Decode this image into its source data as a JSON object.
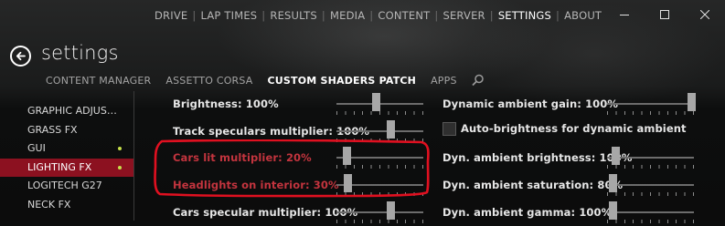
{
  "topnav": {
    "items": [
      {
        "label": "DRIVE",
        "active": false
      },
      {
        "label": "LAP TIMES",
        "active": false
      },
      {
        "label": "RESULTS",
        "active": false
      },
      {
        "label": "MEDIA",
        "active": false
      },
      {
        "label": "CONTENT",
        "active": false
      },
      {
        "label": "SERVER",
        "active": false
      },
      {
        "label": "SETTINGS",
        "active": true
      },
      {
        "label": "ABOUT",
        "active": false
      }
    ],
    "separator": "|"
  },
  "window_controls": [
    "minimize-icon",
    "maximize-icon",
    "close-icon"
  ],
  "page": {
    "title": "settings"
  },
  "subtabs": [
    {
      "label": "CONTENT MANAGER",
      "active": false
    },
    {
      "label": "ASSETTO CORSA",
      "active": false
    },
    {
      "label": "CUSTOM SHADERS PATCH",
      "active": true
    },
    {
      "label": "APPS",
      "active": false
    }
  ],
  "sidebar": {
    "items": [
      {
        "label": "GRAPHIC ADJUS…",
        "active": false,
        "dot": false
      },
      {
        "label": "GRASS FX",
        "active": false,
        "dot": false
      },
      {
        "label": "GUI",
        "active": false,
        "dot": true,
        "dot_color": "#c7e04a"
      },
      {
        "label": "LIGHTING FX",
        "active": true,
        "dot": true,
        "dot_color": "#c7e04a"
      },
      {
        "label": "LOGITECH G27",
        "active": false,
        "dot": false
      },
      {
        "label": "NECK FX",
        "active": false,
        "dot": false
      }
    ]
  },
  "left_settings": [
    {
      "label": "Brightness: 100%",
      "value": 0.45,
      "highlighted": false
    },
    {
      "label": "Track speculars multiplier: 100%",
      "value": 0.62,
      "highlighted": false
    },
    {
      "label": "Cars lit multiplier: 20%",
      "value": 0.12,
      "highlighted": true
    },
    {
      "label": "Headlights on interior: 30%",
      "value": 0.13,
      "highlighted": true
    },
    {
      "label": "Cars specular multiplier: 100%",
      "value": 0.62,
      "highlighted": false
    }
  ],
  "right_settings": [
    {
      "label": "Dynamic ambient gain: 100%",
      "type": "slider",
      "value": 0.97
    },
    {
      "label": "Auto-brightness for dynamic ambient",
      "type": "checkbox",
      "checked": false
    },
    {
      "label": "Dyn. ambient brightness: 100%",
      "type": "slider",
      "value": 0.09
    },
    {
      "label": "Dyn. ambient saturation: 80%",
      "type": "slider",
      "value": 0.06
    },
    {
      "label": "Dyn. ambient gamma: 100%",
      "type": "slider",
      "value": 0.06
    }
  ],
  "colors": {
    "accent_active": "#8c1120",
    "highlight_text": "#c3343e",
    "annotation_outline": "#e01020",
    "status_dot": "#c7e04a"
  }
}
